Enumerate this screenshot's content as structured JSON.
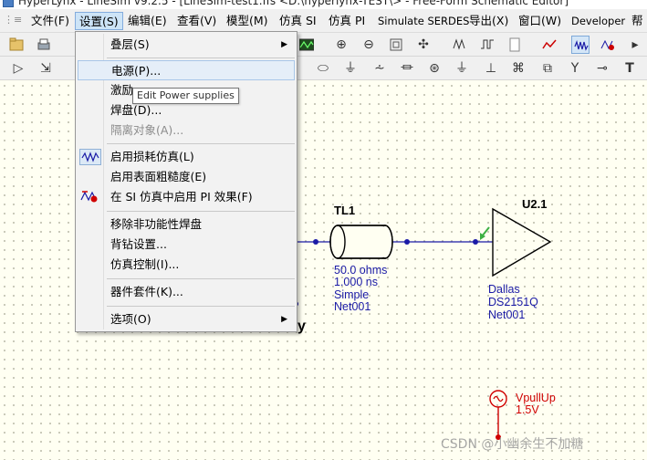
{
  "window": {
    "title": "HyperLynx - LineSim v9.2.5 - [LineSim-test1.ffs <D:\\hyperlynx-TEST\\> - Free-Form Schematic Editor]"
  },
  "menubar": {
    "items": [
      {
        "label": "文件(F)"
      },
      {
        "label": "设置(S)"
      },
      {
        "label": "编辑(E)"
      },
      {
        "label": "查看(V)"
      },
      {
        "label": "模型(M)"
      },
      {
        "label": "仿真 SI"
      },
      {
        "label": "仿真 PI"
      },
      {
        "label": "Simulate SERDES"
      },
      {
        "label": "导出(X)"
      },
      {
        "label": "窗口(W)"
      },
      {
        "label": "Developer"
      },
      {
        "label": "帮"
      }
    ],
    "active": "设置(S)"
  },
  "dropdown": {
    "items": [
      {
        "label": "叠层(S)",
        "submenu": true,
        "state": "normal"
      },
      {
        "label": "电源(P)...",
        "state": "hover"
      },
      {
        "label": "激励",
        "state": "normal"
      },
      {
        "label": "焊盘(D)...",
        "state": "normal"
      },
      {
        "label": "隔离对象(A)...",
        "state": "disabled"
      },
      {
        "label": "启用损耗仿真(L)",
        "icon": "lossy-sim-icon",
        "state": "normal"
      },
      {
        "label": "启用表面粗糙度(E)",
        "state": "normal"
      },
      {
        "label": "在 SI 仿真中启用 PI 效果(F)",
        "icon": "pi-effect-icon",
        "state": "normal"
      },
      {
        "label": "移除非功能性焊盘",
        "state": "normal"
      },
      {
        "label": "背钻设置...",
        "state": "normal"
      },
      {
        "label": "仿真控制(I)...",
        "state": "normal"
      },
      {
        "label": "器件套件(K)...",
        "state": "normal"
      },
      {
        "label": "选项(O)",
        "submenu": true,
        "state": "normal"
      }
    ]
  },
  "tooltip": {
    "text": "Edit Power supplies"
  },
  "schematic": {
    "tl1": {
      "name": "TL1",
      "impedance": "50.0 ohms",
      "delay": "1.000 ns",
      "model": "Simple",
      "net": "Net001"
    },
    "u21": {
      "name": "U2.1",
      "vendor": "Dallas",
      "part": "DS2151Q",
      "net": "Net001"
    },
    "vpullup": {
      "name": "VpullUp",
      "voltage": "1.5V"
    },
    "partial_text": "y"
  },
  "watermark": {
    "text": "CSDN @小幽余生不加糖"
  },
  "colors": {
    "menu_highlight": "#cde4f7",
    "net_blue": "#1a1aa6",
    "source_red": "#d00000",
    "canvas_bg": "#fffff2"
  }
}
